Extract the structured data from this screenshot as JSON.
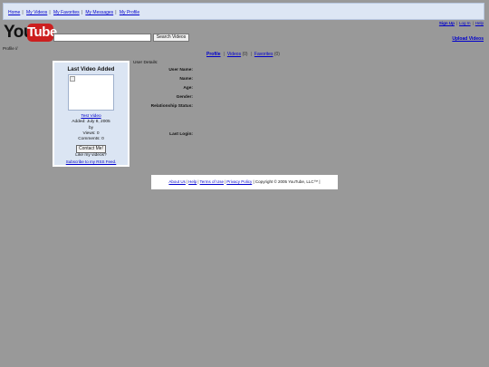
{
  "top_nav": {
    "items": [
      {
        "label": "Home"
      },
      {
        "label": "My Videos"
      },
      {
        "label": "My Favorites"
      },
      {
        "label": "My Messages"
      },
      {
        "label": "My Profile"
      }
    ]
  },
  "logo": {
    "you": "You",
    "tube": "Tube"
  },
  "search": {
    "button_label": "Search Videos",
    "value": ""
  },
  "account_links": {
    "sign_up": "Sign Up",
    "log_in": "Log In",
    "help": "Help"
  },
  "upload_link": "Upload Videos",
  "breadcrumb": "Profile //",
  "profile_tabs": {
    "profile": "Profile",
    "videos": "Videos",
    "videos_count": "(0)",
    "favorites": "Favorites",
    "favorites_count": "(0)"
  },
  "last_video": {
    "title": "Last Video Added",
    "video_link": "Test Video",
    "added": "Added: July 8, 2005",
    "by": "by",
    "views": "Views: 0",
    "comments": "Comments: 0",
    "contact_button": "Contact Me!",
    "like_text": "Like my videos?",
    "rss_link": "Subscribe to my RSS Feed."
  },
  "user_details": {
    "header": "User Details:",
    "fields": [
      {
        "label": "User Name:"
      },
      {
        "label": "Name:"
      },
      {
        "label": "Age:"
      },
      {
        "label": "Gender:"
      },
      {
        "label": "Relationship Status:"
      },
      {
        "label": "Last Login:"
      }
    ]
  },
  "footer": {
    "about": "About Us",
    "help": "Help",
    "terms": "Terms of Use",
    "privacy": "Privacy Policy",
    "copyright": "| Copyright © 2005 YouTube, LLC™ |"
  }
}
